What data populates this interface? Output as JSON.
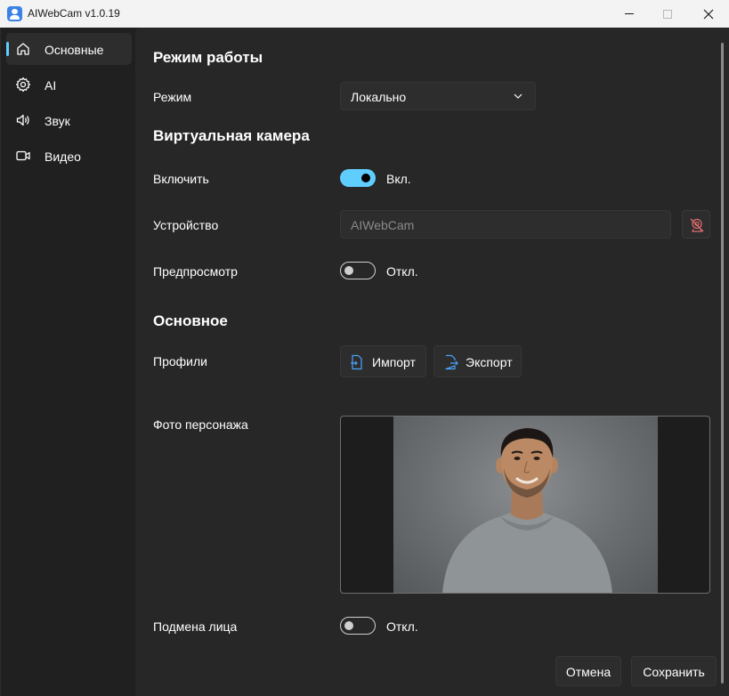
{
  "window": {
    "title": "AIWebCam v1.0.19"
  },
  "sidebar": {
    "items": [
      {
        "label": "Основные",
        "icon": "home-icon",
        "active": true
      },
      {
        "label": "AI",
        "icon": "gear-icon",
        "active": false
      },
      {
        "label": "Звук",
        "icon": "speaker-icon",
        "active": false
      },
      {
        "label": "Видео",
        "icon": "video-camera-icon",
        "active": false
      }
    ]
  },
  "main": {
    "mode_section": {
      "title": "Режим работы",
      "mode_label": "Режим",
      "mode_value": "Локально"
    },
    "virtual_camera": {
      "title": "Виртуальная камера",
      "enable_label": "Включить",
      "enable_state": "Вкл.",
      "enabled": true,
      "device_label": "Устройство",
      "device_value": "AIWebCam",
      "preview_label": "Предпросмотр",
      "preview_state": "Откл.",
      "preview_enabled": false
    },
    "general": {
      "title": "Основное",
      "profiles_label": "Профили",
      "import_label": "Импорт",
      "export_label": "Экспорт",
      "photo_label": "Фото персонажа",
      "face_swap_label": "Подмена лица",
      "face_swap_state": "Откл.",
      "face_swap_enabled": false
    }
  },
  "footer": {
    "cancel_label": "Отмена",
    "save_label": "Сохранить"
  },
  "colors": {
    "accent": "#60cdff",
    "background": "#202020",
    "panel": "#272727",
    "danger_icon": "#e06c6c",
    "import_export_icon": "#4aa3ff"
  }
}
